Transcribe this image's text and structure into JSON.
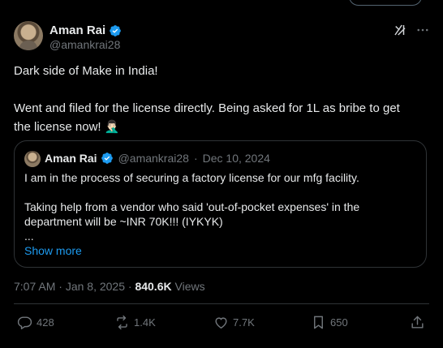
{
  "author": {
    "name": "Aman Rai",
    "handle": "@amankrai28"
  },
  "tweet": {
    "line1": "Dark side of Make in India!",
    "line2": "Went and filed for the license directly. Being asked for 1L as bribe to get",
    "line3": "the license now! 🤦🏻‍♂️"
  },
  "quoted": {
    "name": "Aman Rai",
    "handle": "@amankrai28",
    "separator": "·",
    "date": "Dec 10, 2024",
    "line1": "I am in the process of securing a factory license for our mfg facility.",
    "line2": "Taking help from a vendor who said 'out-of-pocket expenses' in the",
    "line3": "department will be ~INR 70K!!! (IYKYK)",
    "line4": "...",
    "show_more": "Show more"
  },
  "meta": {
    "time": "7:07 AM",
    "separator1": "·",
    "date": "Jan 8, 2025",
    "separator2": "·",
    "views_count": "840.6K",
    "views_label": "Views"
  },
  "actions": {
    "replies": "428",
    "reposts": "1.4K",
    "likes": "7.7K",
    "bookmarks": "650"
  },
  "colors": {
    "background": "#000000",
    "text": "#e7e9ea",
    "muted": "#71767b",
    "accent": "#1d9bf0",
    "border": "#2f3336"
  },
  "icons": [
    "verified-badge-icon",
    "grok-icon",
    "more-icon",
    "reply-icon",
    "repost-icon",
    "like-icon",
    "bookmark-icon",
    "share-icon"
  ]
}
